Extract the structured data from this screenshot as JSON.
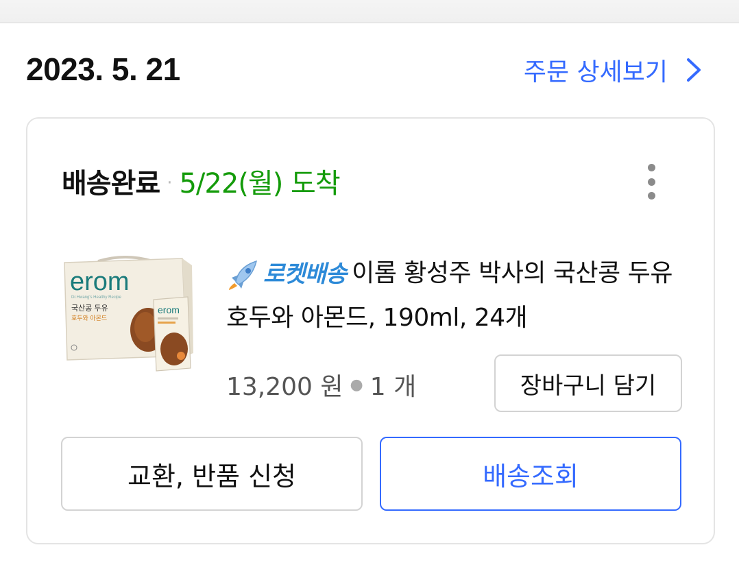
{
  "order": {
    "date": "2023. 5. 21",
    "detail_link_label": "주문 상세보기"
  },
  "shipment": {
    "status": "배송완료",
    "separator": "·",
    "arrival": "5/22(월) 도착"
  },
  "product": {
    "badge_label": "로켓배송",
    "title": "이롬 황성주 박사의 국산콩 두유 호두와 아몬드, 190ml, 24개",
    "price": "13,200 원",
    "quantity": "1 개",
    "image_brand": "erom",
    "image_box_text": "국산콩 두유",
    "image_box_subtext": "호두와 아몬드"
  },
  "actions": {
    "add_to_cart": "장바구니 담기",
    "exchange_return": "교환, 반품 신청",
    "track_delivery": "배송조회"
  },
  "colors": {
    "accent_blue": "#346aff",
    "arrival_green": "#149b0a",
    "rocket_blue": "#2d8ad8"
  }
}
